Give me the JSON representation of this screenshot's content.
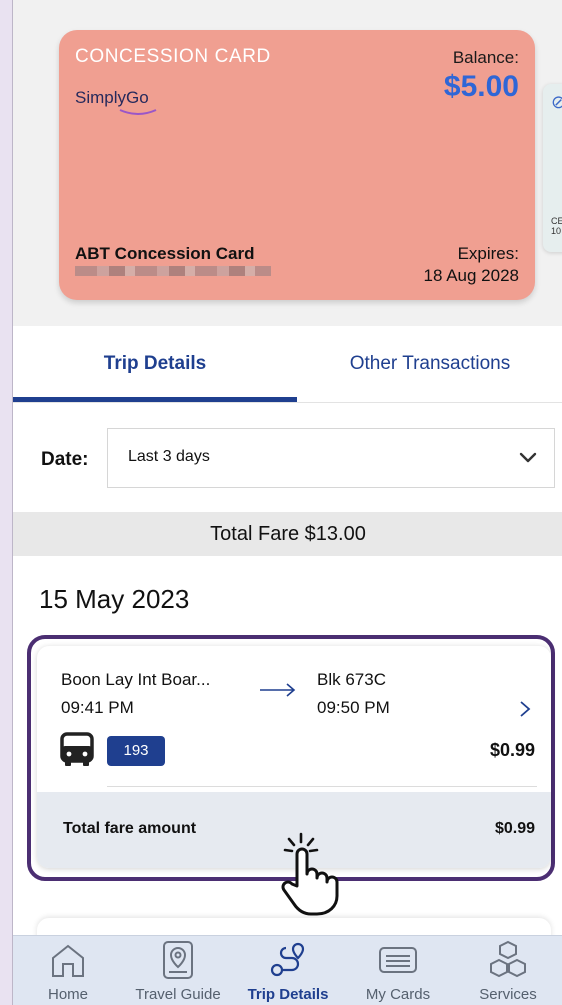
{
  "card": {
    "title": "CONCESSION CARD",
    "logo_text": "SimplyGo",
    "balance_label": "Balance:",
    "balance_value": "$5.00",
    "name": "ABT Concession Card",
    "expires_label": "Expires:",
    "expires_value": "18 Aug 2028",
    "color": "#f09f91"
  },
  "next_card_peek": {
    "text_line1": "CE",
    "text_line2": "10"
  },
  "tabs": [
    {
      "label": "Trip Details",
      "active": true
    },
    {
      "label": "Other Transactions",
      "active": false
    }
  ],
  "filter": {
    "label": "Date:",
    "selected": "Last 3 days"
  },
  "total_fare": "Total Fare $13.00",
  "section_date": "15 May 2023",
  "trip": {
    "from_stop": "Boon Lay Int Boar...",
    "from_time": "09:41 PM",
    "to_stop": "Blk 673C",
    "to_time": "09:50 PM",
    "mode_icon": "bus-icon",
    "route": "193",
    "fare": "$0.99",
    "total_label": "Total fare amount",
    "total_value": "$0.99"
  },
  "bottom_nav": [
    {
      "label": "Home",
      "icon": "home-icon"
    },
    {
      "label": "Travel Guide",
      "icon": "map-pin-icon"
    },
    {
      "label": "Trip Details",
      "icon": "route-icon",
      "active": true
    },
    {
      "label": "My Cards",
      "icon": "card-icon"
    },
    {
      "label": "Services",
      "icon": "boxes-icon"
    }
  ],
  "colors": {
    "primary": "#1f3f8f",
    "balance": "#2f66d6",
    "highlight_border": "#4b2e72",
    "nav_bg": "#dfe6f2"
  }
}
